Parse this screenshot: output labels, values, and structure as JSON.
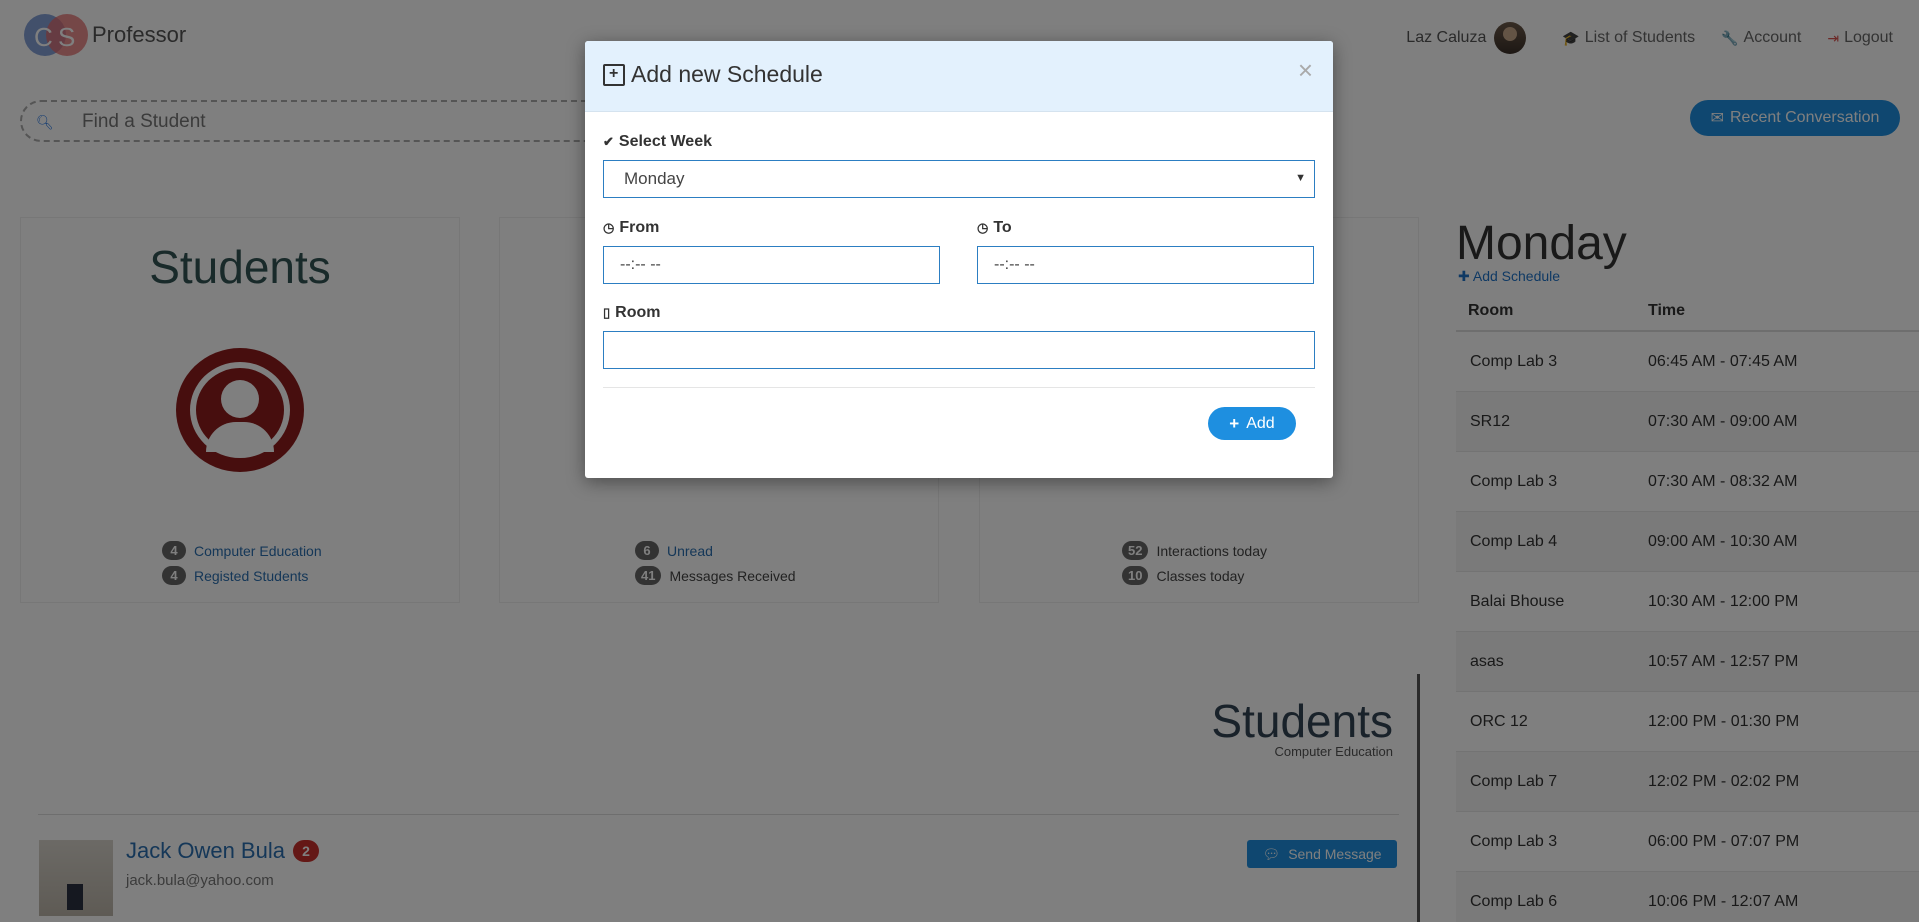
{
  "nav": {
    "brand_logo_left": "C",
    "brand_logo_right": "S",
    "brand_name": "Professor",
    "user_name": "Laz Caluza",
    "list_students": "List of Students",
    "account": "Account",
    "logout": "Logout"
  },
  "search": {
    "placeholder": "Find a Student"
  },
  "recent_button": "Recent Conversation",
  "cards": [
    {
      "title": "Students",
      "stats": [
        {
          "count": "4",
          "label": "Computer Education"
        },
        {
          "count": "4",
          "label": "Registed Students"
        }
      ]
    },
    {
      "title": "",
      "stats": [
        {
          "count": "6",
          "label": "Unread"
        },
        {
          "count": "41",
          "label": "Messages Received"
        }
      ]
    },
    {
      "title": "",
      "stats": [
        {
          "count": "52",
          "label": "Interactions today"
        },
        {
          "count": "10",
          "label": "Classes today"
        }
      ]
    }
  ],
  "schedule": {
    "day": "Monday",
    "add_link": "Add Schedule",
    "headers": {
      "room": "Room",
      "time": "Time"
    },
    "rows": [
      {
        "room": "Comp Lab 3",
        "time": "06:45 AM - 07:45 AM"
      },
      {
        "room": "SR12",
        "time": "07:30 AM - 09:00 AM"
      },
      {
        "room": "Comp Lab 3",
        "time": "07:30 AM - 08:32 AM"
      },
      {
        "room": "Comp Lab 4",
        "time": "09:00 AM - 10:30 AM"
      },
      {
        "room": "Balai Bhouse",
        "time": "10:30 AM - 12:00 PM"
      },
      {
        "room": "asas",
        "time": "10:57 AM - 12:57 PM"
      },
      {
        "room": "ORC 12",
        "time": "12:00 PM - 01:30 PM"
      },
      {
        "room": "Comp Lab 7",
        "time": "12:02 PM - 02:02 PM"
      },
      {
        "room": "Comp Lab 3",
        "time": "06:00 PM - 07:07 PM"
      },
      {
        "room": "Comp Lab 6",
        "time": "10:06 PM - 12:07 AM"
      }
    ]
  },
  "students_panel": {
    "title": "Students",
    "subtitle": "Computer Education",
    "student": {
      "name": "Jack Owen Bula",
      "badge": "2",
      "email": "jack.bula@yahoo.com",
      "send_label": "Send Message"
    }
  },
  "modal": {
    "title": "Add new Schedule",
    "close": "×",
    "week_label": "Select Week",
    "week_value": "Monday",
    "from_label": "From",
    "from_value": "--:-- --",
    "to_label": "To",
    "to_value": "--:-- --",
    "room_label": "Room",
    "room_value": "",
    "add_label": "Add"
  },
  "colors": {
    "accent": "#1e8fe0",
    "modal_header": "#e3f1fd",
    "card_icon": "#8e1c1c",
    "badge_red": "#c9302c"
  }
}
